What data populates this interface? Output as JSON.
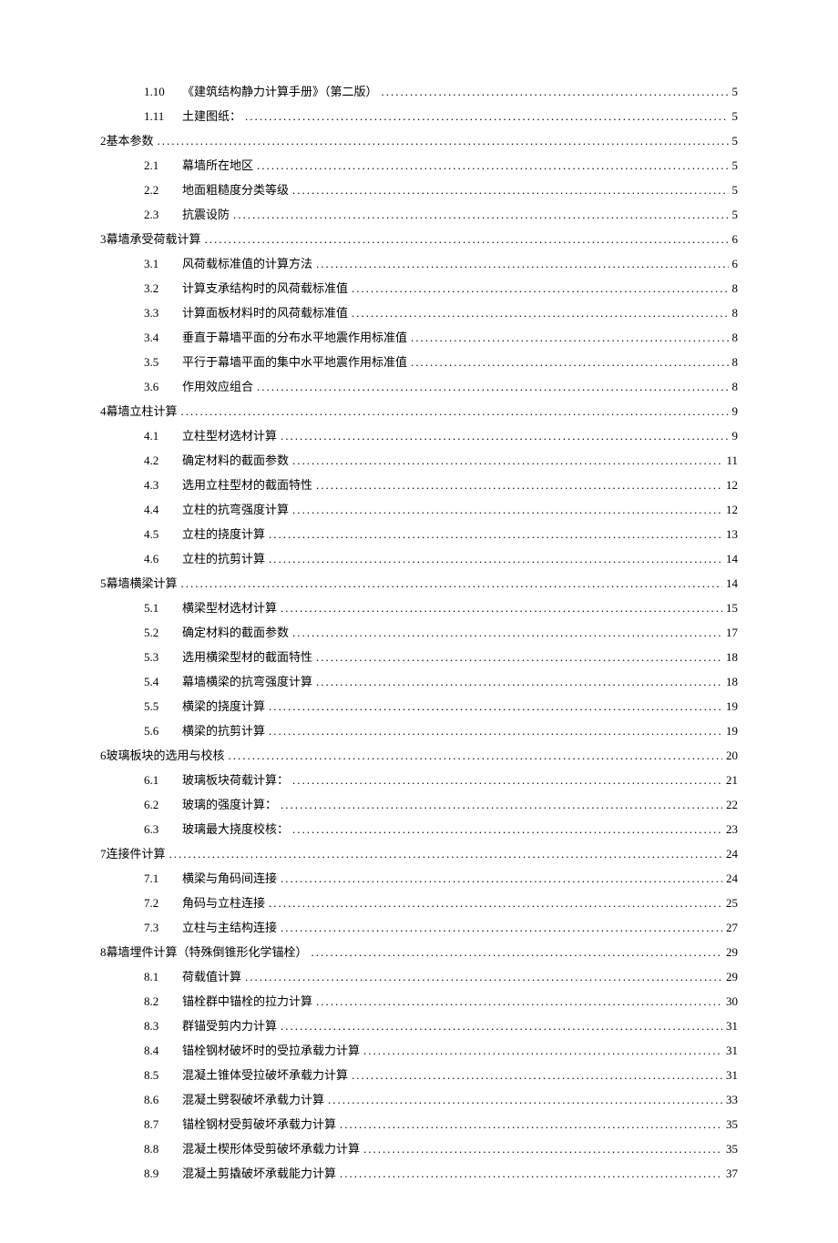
{
  "toc": [
    {
      "level": 2,
      "num": "1.10",
      "label": "《建筑结构静力计算手册》（第二版）",
      "page": "5"
    },
    {
      "level": 2,
      "num": "1.11",
      "label": "土建图纸：",
      "page": "5"
    },
    {
      "level": 1,
      "num": "2",
      "label": "基本参数",
      "page": "5"
    },
    {
      "level": 2,
      "num": "2.1",
      "label": "幕墙所在地区",
      "page": "5"
    },
    {
      "level": 2,
      "num": "2.2",
      "label": "地面粗糙度分类等级",
      "page": "5"
    },
    {
      "level": 2,
      "num": "2.3",
      "label": "抗震设防",
      "page": "5"
    },
    {
      "level": 1,
      "num": "3",
      "label": "幕墙承受荷载计算",
      "page": "6"
    },
    {
      "level": 2,
      "num": "3.1",
      "label": "风荷载标准值的计算方法",
      "page": "6"
    },
    {
      "level": 2,
      "num": "3.2",
      "label": "计算支承结构时的风荷载标准值",
      "page": "8"
    },
    {
      "level": 2,
      "num": "3.3",
      "label": "计算面板材料时的风荷载标准值",
      "page": "8"
    },
    {
      "level": 2,
      "num": "3.4",
      "label": "垂直于幕墙平面的分布水平地震作用标准值",
      "page": "8"
    },
    {
      "level": 2,
      "num": "3.5",
      "label": "平行于幕墙平面的集中水平地震作用标准值",
      "page": "8"
    },
    {
      "level": 2,
      "num": "3.6",
      "label": "作用效应组合",
      "page": "8"
    },
    {
      "level": 1,
      "num": "4",
      "label": "幕墙立柱计算",
      "page": "9"
    },
    {
      "level": 2,
      "num": "4.1",
      "label": "立柱型材选材计算",
      "page": "9"
    },
    {
      "level": 2,
      "num": "4.2",
      "label": "确定材料的截面参数",
      "page": "11"
    },
    {
      "level": 2,
      "num": "4.3",
      "label": "选用立柱型材的截面特性",
      "page": "12"
    },
    {
      "level": 2,
      "num": "4.4",
      "label": "立柱的抗弯强度计算",
      "page": "12"
    },
    {
      "level": 2,
      "num": "4.5",
      "label": "立柱的挠度计算",
      "page": "13"
    },
    {
      "level": 2,
      "num": "4.6",
      "label": "立柱的抗剪计算",
      "page": "14"
    },
    {
      "level": 1,
      "num": "5",
      "label": "幕墙横梁计算",
      "page": "14"
    },
    {
      "level": 2,
      "num": "5.1",
      "label": "横梁型材选材计算",
      "page": "15"
    },
    {
      "level": 2,
      "num": "5.2",
      "label": "确定材料的截面参数",
      "page": "17"
    },
    {
      "level": 2,
      "num": "5.3",
      "label": "选用横梁型材的截面特性",
      "page": "18"
    },
    {
      "level": 2,
      "num": "5.4",
      "label": "幕墙横梁的抗弯强度计算",
      "page": "18"
    },
    {
      "level": 2,
      "num": "5.5",
      "label": "横梁的挠度计算",
      "page": "19"
    },
    {
      "level": 2,
      "num": "5.6",
      "label": "横梁的抗剪计算",
      "page": "19"
    },
    {
      "level": 1,
      "num": "6",
      "label": "玻璃板块的选用与校核",
      "page": "20"
    },
    {
      "level": 2,
      "num": "6.1",
      "label": "玻璃板块荷载计算：",
      "page": "21"
    },
    {
      "level": 2,
      "num": "6.2",
      "label": "玻璃的强度计算：",
      "page": "22"
    },
    {
      "level": 2,
      "num": "6.3",
      "label": "玻璃最大挠度校核：",
      "page": "23"
    },
    {
      "level": 1,
      "num": "7",
      "label": "连接件计算",
      "page": "24"
    },
    {
      "level": 2,
      "num": "7.1",
      "label": "横梁与角码间连接",
      "page": "24"
    },
    {
      "level": 2,
      "num": "7.2",
      "label": "角码与立柱连接",
      "page": "25"
    },
    {
      "level": 2,
      "num": "7.3",
      "label": "立柱与主结构连接",
      "page": "27"
    },
    {
      "level": 1,
      "num": "8",
      "label": "幕墙埋件计算（特殊倒锥形化学锚栓）",
      "page": "29"
    },
    {
      "level": 2,
      "num": "8.1",
      "label": "荷载值计算",
      "page": "29"
    },
    {
      "level": 2,
      "num": "8.2",
      "label": "锚栓群中锚栓的拉力计算",
      "page": "30"
    },
    {
      "level": 2,
      "num": "8.3",
      "label": "群锚受剪内力计算",
      "page": "31"
    },
    {
      "level": 2,
      "num": "8.4",
      "label": "锚栓钢材破坏时的受拉承载力计算",
      "page": "31"
    },
    {
      "level": 2,
      "num": "8.5",
      "label": "混凝土锥体受拉破坏承载力计算",
      "page": "31"
    },
    {
      "level": 2,
      "num": "8.6",
      "label": "混凝土劈裂破坏承载力计算",
      "page": "33"
    },
    {
      "level": 2,
      "num": "8.7",
      "label": "锚栓钢材受剪破坏承载力计算",
      "page": "35"
    },
    {
      "level": 2,
      "num": "8.8",
      "label": "混凝土楔形体受剪破坏承载力计算",
      "page": "35"
    },
    {
      "level": 2,
      "num": "8.9",
      "label": "混凝土剪撬破坏承载能力计算",
      "page": "37"
    }
  ]
}
